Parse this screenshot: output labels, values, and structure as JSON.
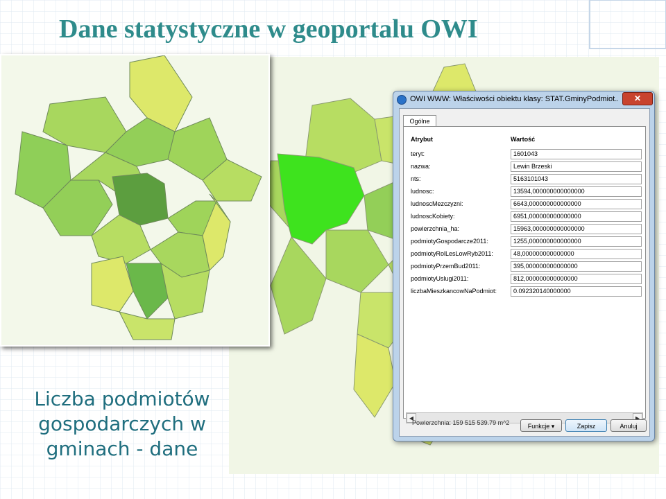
{
  "slide": {
    "title": "Dane statystyczne w geoportalu OWI",
    "caption": "Liczba podmiotów gospodarczych w gminach - dane"
  },
  "dialog": {
    "title": "OWI WWW: Właściwości obiektu klasy: STAT.GminyPodmiot...",
    "close_glyph": "✕",
    "tab_label": "Ogólne",
    "col_attr": "Atrybut",
    "col_value": "Wartość",
    "attributes": [
      {
        "name": "teryt:",
        "value": "1601043"
      },
      {
        "name": "nazwa:",
        "value": "Lewin Brzeski"
      },
      {
        "name": "nts:",
        "value": "5163101043"
      },
      {
        "name": "ludnosc:",
        "value": "13594,000000000000000"
      },
      {
        "name": "ludnoscMezczyzni:",
        "value": "6643,000000000000000"
      },
      {
        "name": "ludnoscKobiety:",
        "value": "6951,000000000000000"
      },
      {
        "name": "powierzchnia_ha:",
        "value": "15963,000000000000000"
      },
      {
        "name": "podmiotyGospodarcze2011:",
        "value": "1255,000000000000000"
      },
      {
        "name": "podmiotyRolLesLowRyb2011:",
        "value": "48,000000000000000"
      },
      {
        "name": "podmiotyPrzemBud2011:",
        "value": "395,000000000000000"
      },
      {
        "name": "podmiotyUslugi2011:",
        "value": "812,000000000000000"
      },
      {
        "name": "liczbaMieszkancowNaPodmiot:",
        "value": "0.092320140000000"
      }
    ],
    "scroll_left": "◀",
    "scroll_right": "▶",
    "footer_area": "Powierzchnia: 159 515 539.79 m^2",
    "functions_button": "Funkcje ▾",
    "save_button": "Zapisz",
    "cancel_button": "Anuluj"
  },
  "colors": {
    "title": "#2e8b8b",
    "caption": "#1f6e7e",
    "selected_gmina": "#3ee31e",
    "map_light": "#d9e85b",
    "map_mid": "#9fd45a",
    "map_dark": "#5c9e3f"
  },
  "icons": {
    "app": "owi-app-icon",
    "close": "close-icon"
  }
}
